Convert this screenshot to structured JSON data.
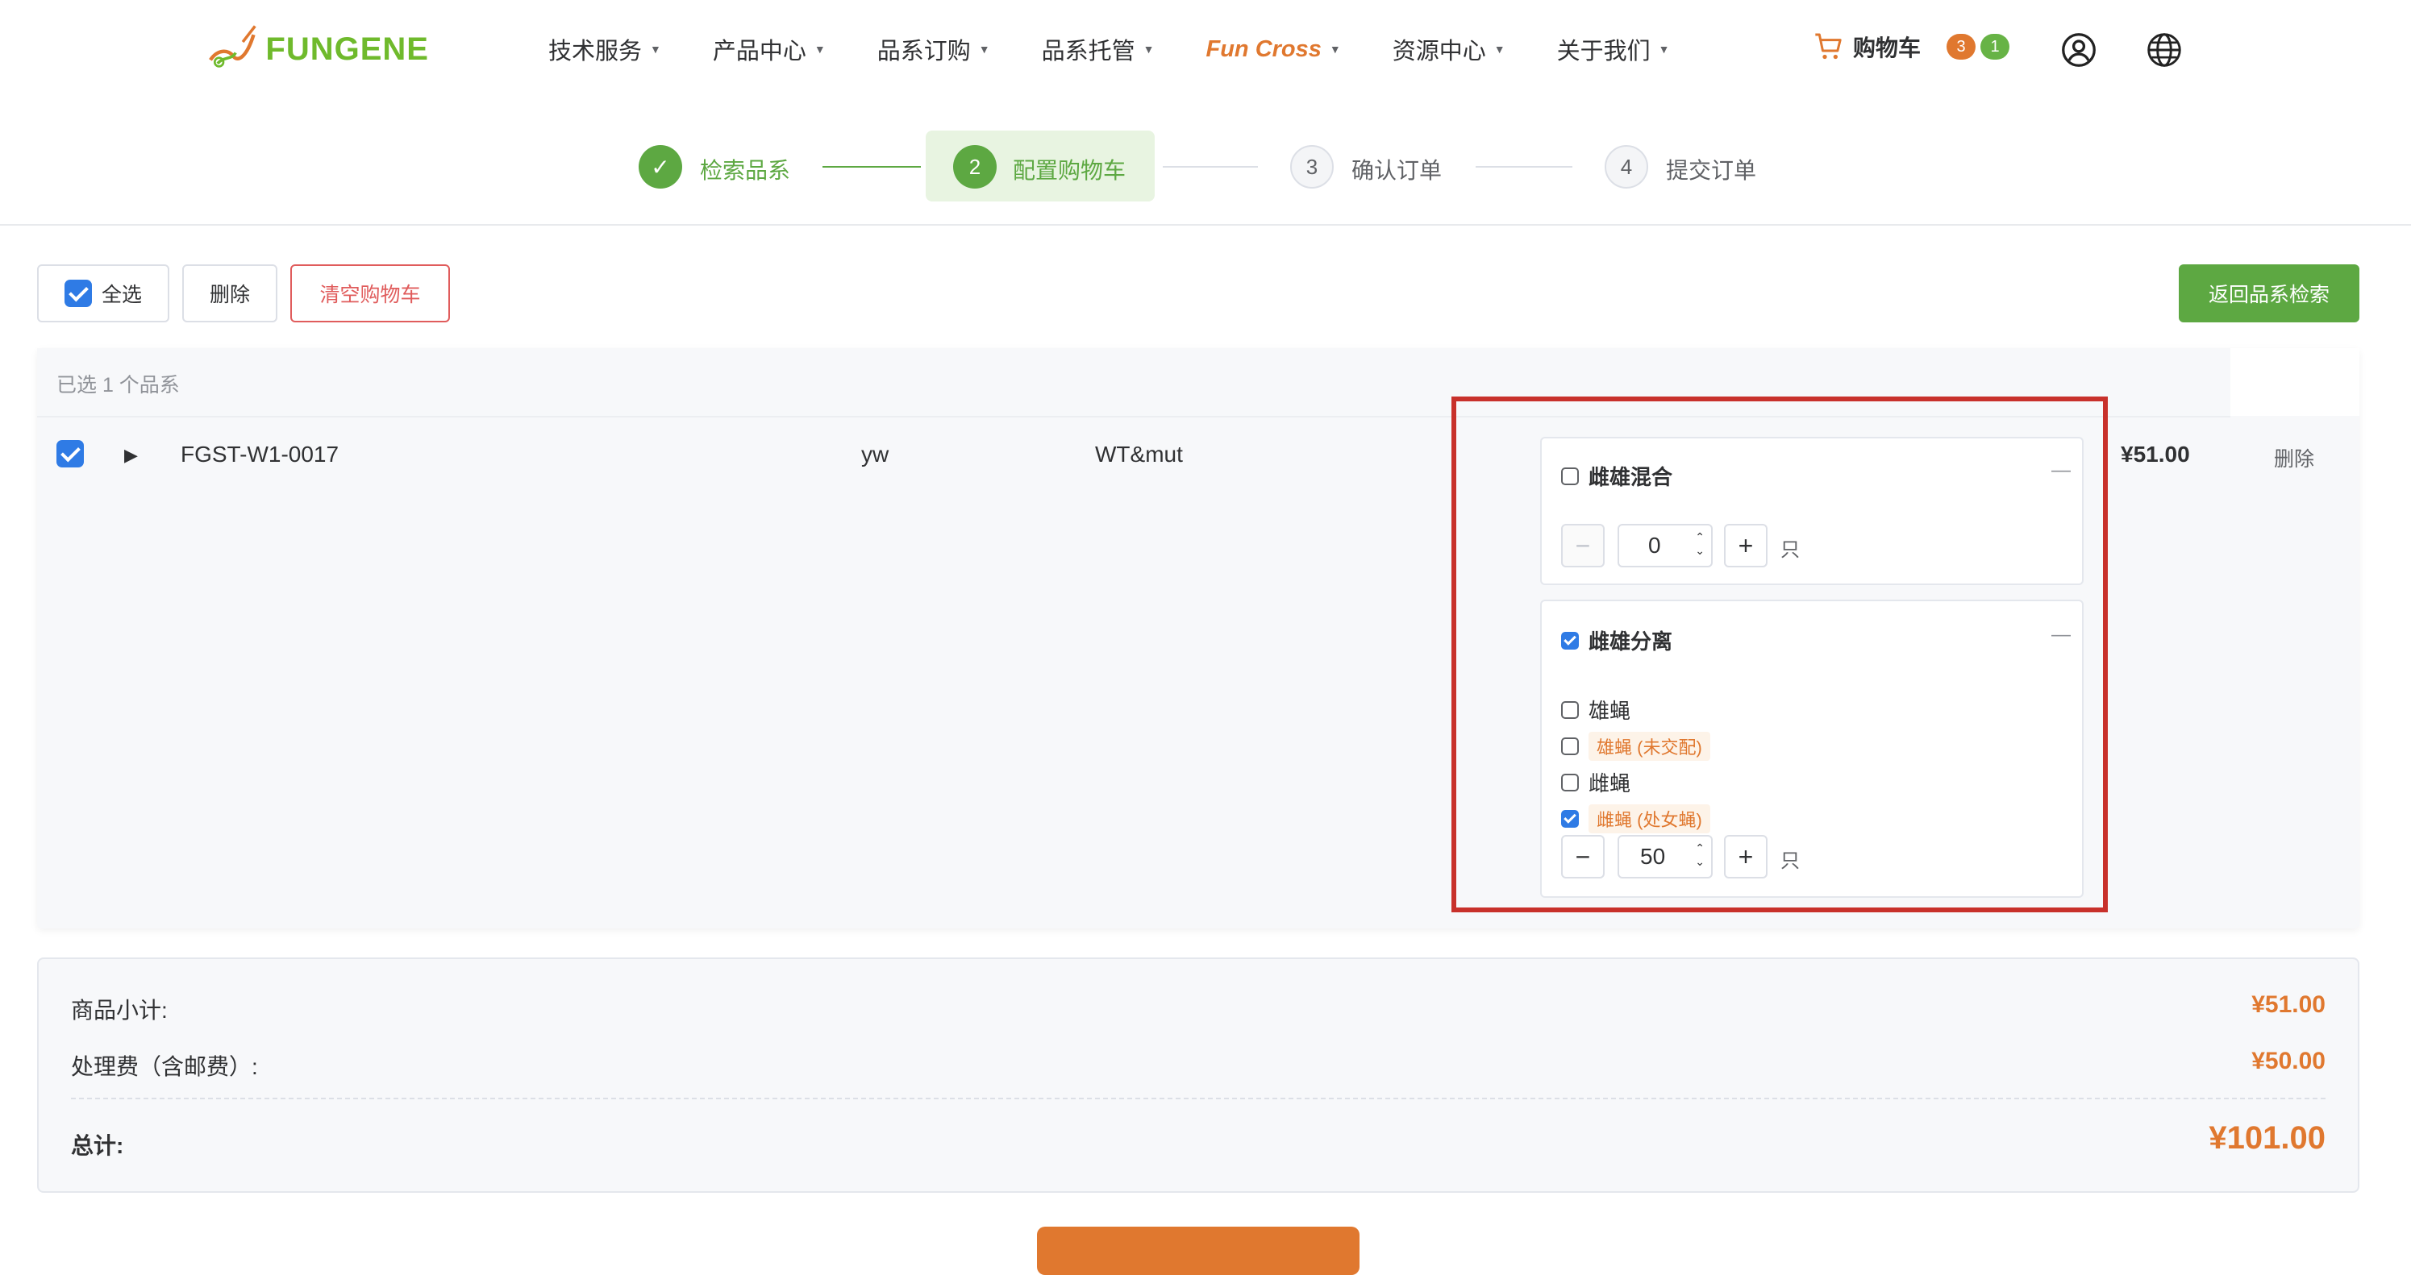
{
  "header": {
    "logo_text": "FUNGENE",
    "nav": [
      "技术服务",
      "产品中心",
      "品系订购",
      "品系托管",
      "Fun Cross",
      "资源中心",
      "关于我们"
    ],
    "active_nav": "Fun Cross",
    "cart_label": "购物车",
    "cart_badge_1": "3",
    "cart_badge_2": "1"
  },
  "steps": [
    {
      "num": "✓",
      "label": "检索品系",
      "state": "done"
    },
    {
      "num": "2",
      "label": "配置购物车",
      "state": "current"
    },
    {
      "num": "3",
      "label": "确认订单",
      "state": "pending"
    },
    {
      "num": "4",
      "label": "提交订单",
      "state": "pending"
    }
  ],
  "toolbar": {
    "select_all": "全选",
    "delete": "删除",
    "clear_cart": "清空购物车",
    "back_search": "返回品系检索"
  },
  "table": {
    "selected_info": "已选 1 个品系",
    "row": {
      "id": "FGST-W1-0017",
      "name": "yw",
      "genotype": "WT&mut",
      "price": "¥51.00",
      "delete": "删除"
    }
  },
  "options": {
    "mixed": {
      "label": "雌雄混合",
      "checked": false,
      "qty": "0",
      "unit": "只"
    },
    "separated": {
      "label": "雌雄分离",
      "checked": true,
      "sub": [
        {
          "label": "雄蝇",
          "checked": false,
          "tag": false
        },
        {
          "label": "雄蝇 (未交配)",
          "checked": false,
          "tag": true
        },
        {
          "label": "雌蝇",
          "checked": false,
          "tag": false
        },
        {
          "label": "雌蝇 (处女蝇)",
          "checked": true,
          "tag": true
        }
      ],
      "qty": "50",
      "unit": "只"
    }
  },
  "summary": {
    "subtotal_label": "商品小计:",
    "subtotal": "¥51.00",
    "fee_label": "处理费（含邮费）:",
    "fee": "¥50.00",
    "total_label": "总计:",
    "total": "¥101.00"
  },
  "colors": {
    "brand_green": "#5da842",
    "brand_orange": "#e0782f",
    "checkbox_blue": "#2f7be5",
    "highlight_red": "#c8312b"
  }
}
